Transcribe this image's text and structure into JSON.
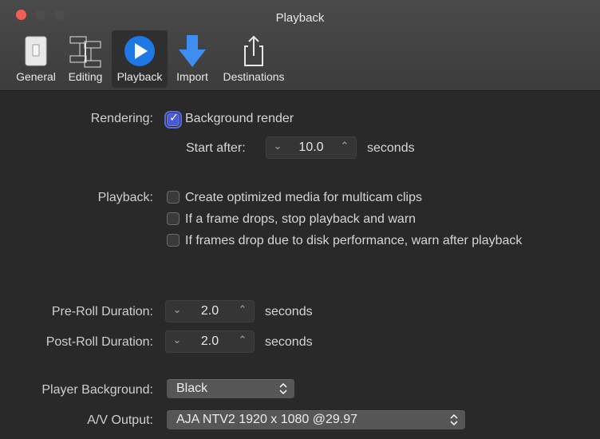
{
  "window": {
    "title": "Playback"
  },
  "toolbar": {
    "items": [
      {
        "label": "General",
        "icon": "switch-icon"
      },
      {
        "label": "Editing",
        "icon": "film-strip-icon"
      },
      {
        "label": "Playback",
        "icon": "play-icon"
      },
      {
        "label": "Import",
        "icon": "import-arrow-icon"
      },
      {
        "label": "Destinations",
        "icon": "share-icon"
      }
    ],
    "selected": "Playback"
  },
  "rendering": {
    "label": "Rendering:",
    "background_render": {
      "label": "Background render",
      "checked": true
    },
    "start_after": {
      "label": "Start after:",
      "value": "10.0",
      "unit": "seconds"
    }
  },
  "playback": {
    "label": "Playback:",
    "options": [
      {
        "label": "Create optimized media for multicam clips",
        "checked": false
      },
      {
        "label": "If a frame drops, stop playback and warn",
        "checked": false
      },
      {
        "label": "If frames drop due to disk performance, warn after playback",
        "checked": false
      }
    ]
  },
  "pre_roll": {
    "label": "Pre-Roll Duration:",
    "value": "2.0",
    "unit": "seconds"
  },
  "post_roll": {
    "label": "Post-Roll Duration:",
    "value": "2.0",
    "unit": "seconds"
  },
  "player_background": {
    "label": "Player Background:",
    "value": "Black"
  },
  "av_output": {
    "label": "A/V Output:",
    "value": "AJA NTV2 1920 x 1080 @29.97"
  },
  "colors": {
    "accent": "#4a5bd6",
    "play_icon": "#1e78e6",
    "close": "#ee5f57"
  }
}
